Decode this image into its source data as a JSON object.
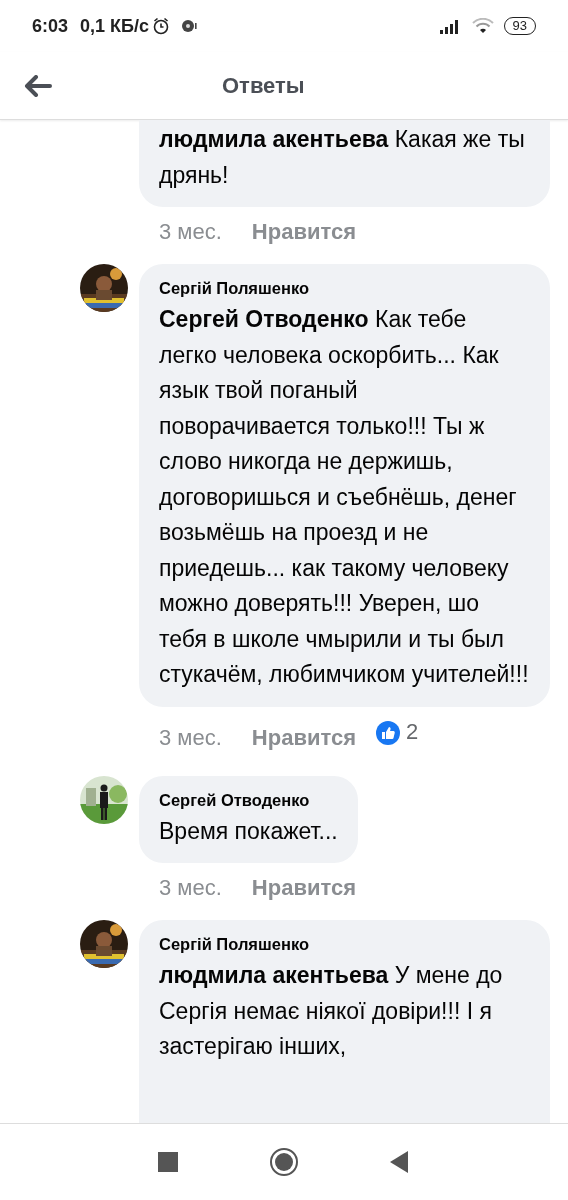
{
  "status_bar": {
    "time": "6:03",
    "speed": "0,1 КБ/с",
    "battery": "93"
  },
  "header": {
    "title": "Ответы"
  },
  "comments": [
    {
      "text": "**людмила акентьева** Какая же ты дрянь!",
      "time": "3 мес.",
      "like_label": "Нравится"
    },
    {
      "author": "Сергій Поляшенко",
      "text": "**Сергей Отводенко** Как тебе легко человека оскорбить... Как язык твой поганый поворачивается только!!! Ты ж слово никогда не держишь, договоришься  и съебнёшь, денег возьмёшь на проезд и не приедешь... как такому человеку можно доверять!!! Уверен, шо тебя в школе чмырили и ты был стукачём, любимчиком учителей!!!",
      "time": "3 мес.",
      "like_label": "Нравится",
      "reactions": "2"
    },
    {
      "author": "Сергей Отводенко",
      "text": "Время покажет...",
      "time": "3 мес.",
      "like_label": "Нравится"
    },
    {
      "author": "Сергій Поляшенко",
      "text": "**людмила акентьева** У мене до Сергія немає ніякої довіри!!! І я застерігаю інших,"
    }
  ]
}
